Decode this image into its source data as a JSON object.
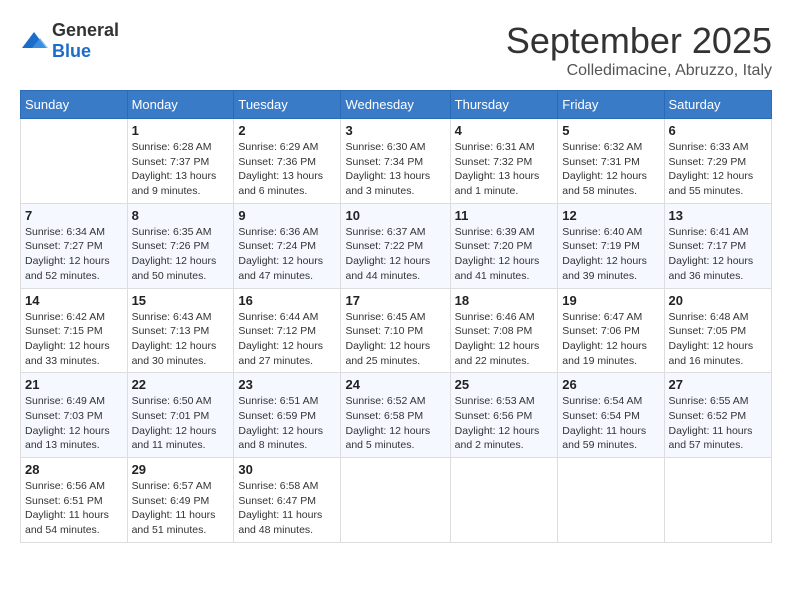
{
  "logo": {
    "general": "General",
    "blue": "Blue"
  },
  "header": {
    "month": "September 2025",
    "location": "Colledimacine, Abruzzo, Italy"
  },
  "weekdays": [
    "Sunday",
    "Monday",
    "Tuesday",
    "Wednesday",
    "Thursday",
    "Friday",
    "Saturday"
  ],
  "weeks": [
    [
      {
        "day": "",
        "info": ""
      },
      {
        "day": "1",
        "info": "Sunrise: 6:28 AM\nSunset: 7:37 PM\nDaylight: 13 hours\nand 9 minutes."
      },
      {
        "day": "2",
        "info": "Sunrise: 6:29 AM\nSunset: 7:36 PM\nDaylight: 13 hours\nand 6 minutes."
      },
      {
        "day": "3",
        "info": "Sunrise: 6:30 AM\nSunset: 7:34 PM\nDaylight: 13 hours\nand 3 minutes."
      },
      {
        "day": "4",
        "info": "Sunrise: 6:31 AM\nSunset: 7:32 PM\nDaylight: 13 hours\nand 1 minute."
      },
      {
        "day": "5",
        "info": "Sunrise: 6:32 AM\nSunset: 7:31 PM\nDaylight: 12 hours\nand 58 minutes."
      },
      {
        "day": "6",
        "info": "Sunrise: 6:33 AM\nSunset: 7:29 PM\nDaylight: 12 hours\nand 55 minutes."
      }
    ],
    [
      {
        "day": "7",
        "info": "Sunrise: 6:34 AM\nSunset: 7:27 PM\nDaylight: 12 hours\nand 52 minutes."
      },
      {
        "day": "8",
        "info": "Sunrise: 6:35 AM\nSunset: 7:26 PM\nDaylight: 12 hours\nand 50 minutes."
      },
      {
        "day": "9",
        "info": "Sunrise: 6:36 AM\nSunset: 7:24 PM\nDaylight: 12 hours\nand 47 minutes."
      },
      {
        "day": "10",
        "info": "Sunrise: 6:37 AM\nSunset: 7:22 PM\nDaylight: 12 hours\nand 44 minutes."
      },
      {
        "day": "11",
        "info": "Sunrise: 6:39 AM\nSunset: 7:20 PM\nDaylight: 12 hours\nand 41 minutes."
      },
      {
        "day": "12",
        "info": "Sunrise: 6:40 AM\nSunset: 7:19 PM\nDaylight: 12 hours\nand 39 minutes."
      },
      {
        "day": "13",
        "info": "Sunrise: 6:41 AM\nSunset: 7:17 PM\nDaylight: 12 hours\nand 36 minutes."
      }
    ],
    [
      {
        "day": "14",
        "info": "Sunrise: 6:42 AM\nSunset: 7:15 PM\nDaylight: 12 hours\nand 33 minutes."
      },
      {
        "day": "15",
        "info": "Sunrise: 6:43 AM\nSunset: 7:13 PM\nDaylight: 12 hours\nand 30 minutes."
      },
      {
        "day": "16",
        "info": "Sunrise: 6:44 AM\nSunset: 7:12 PM\nDaylight: 12 hours\nand 27 minutes."
      },
      {
        "day": "17",
        "info": "Sunrise: 6:45 AM\nSunset: 7:10 PM\nDaylight: 12 hours\nand 25 minutes."
      },
      {
        "day": "18",
        "info": "Sunrise: 6:46 AM\nSunset: 7:08 PM\nDaylight: 12 hours\nand 22 minutes."
      },
      {
        "day": "19",
        "info": "Sunrise: 6:47 AM\nSunset: 7:06 PM\nDaylight: 12 hours\nand 19 minutes."
      },
      {
        "day": "20",
        "info": "Sunrise: 6:48 AM\nSunset: 7:05 PM\nDaylight: 12 hours\nand 16 minutes."
      }
    ],
    [
      {
        "day": "21",
        "info": "Sunrise: 6:49 AM\nSunset: 7:03 PM\nDaylight: 12 hours\nand 13 minutes."
      },
      {
        "day": "22",
        "info": "Sunrise: 6:50 AM\nSunset: 7:01 PM\nDaylight: 12 hours\nand 11 minutes."
      },
      {
        "day": "23",
        "info": "Sunrise: 6:51 AM\nSunset: 6:59 PM\nDaylight: 12 hours\nand 8 minutes."
      },
      {
        "day": "24",
        "info": "Sunrise: 6:52 AM\nSunset: 6:58 PM\nDaylight: 12 hours\nand 5 minutes."
      },
      {
        "day": "25",
        "info": "Sunrise: 6:53 AM\nSunset: 6:56 PM\nDaylight: 12 hours\nand 2 minutes."
      },
      {
        "day": "26",
        "info": "Sunrise: 6:54 AM\nSunset: 6:54 PM\nDaylight: 11 hours\nand 59 minutes."
      },
      {
        "day": "27",
        "info": "Sunrise: 6:55 AM\nSunset: 6:52 PM\nDaylight: 11 hours\nand 57 minutes."
      }
    ],
    [
      {
        "day": "28",
        "info": "Sunrise: 6:56 AM\nSunset: 6:51 PM\nDaylight: 11 hours\nand 54 minutes."
      },
      {
        "day": "29",
        "info": "Sunrise: 6:57 AM\nSunset: 6:49 PM\nDaylight: 11 hours\nand 51 minutes."
      },
      {
        "day": "30",
        "info": "Sunrise: 6:58 AM\nSunset: 6:47 PM\nDaylight: 11 hours\nand 48 minutes."
      },
      {
        "day": "",
        "info": ""
      },
      {
        "day": "",
        "info": ""
      },
      {
        "day": "",
        "info": ""
      },
      {
        "day": "",
        "info": ""
      }
    ]
  ]
}
